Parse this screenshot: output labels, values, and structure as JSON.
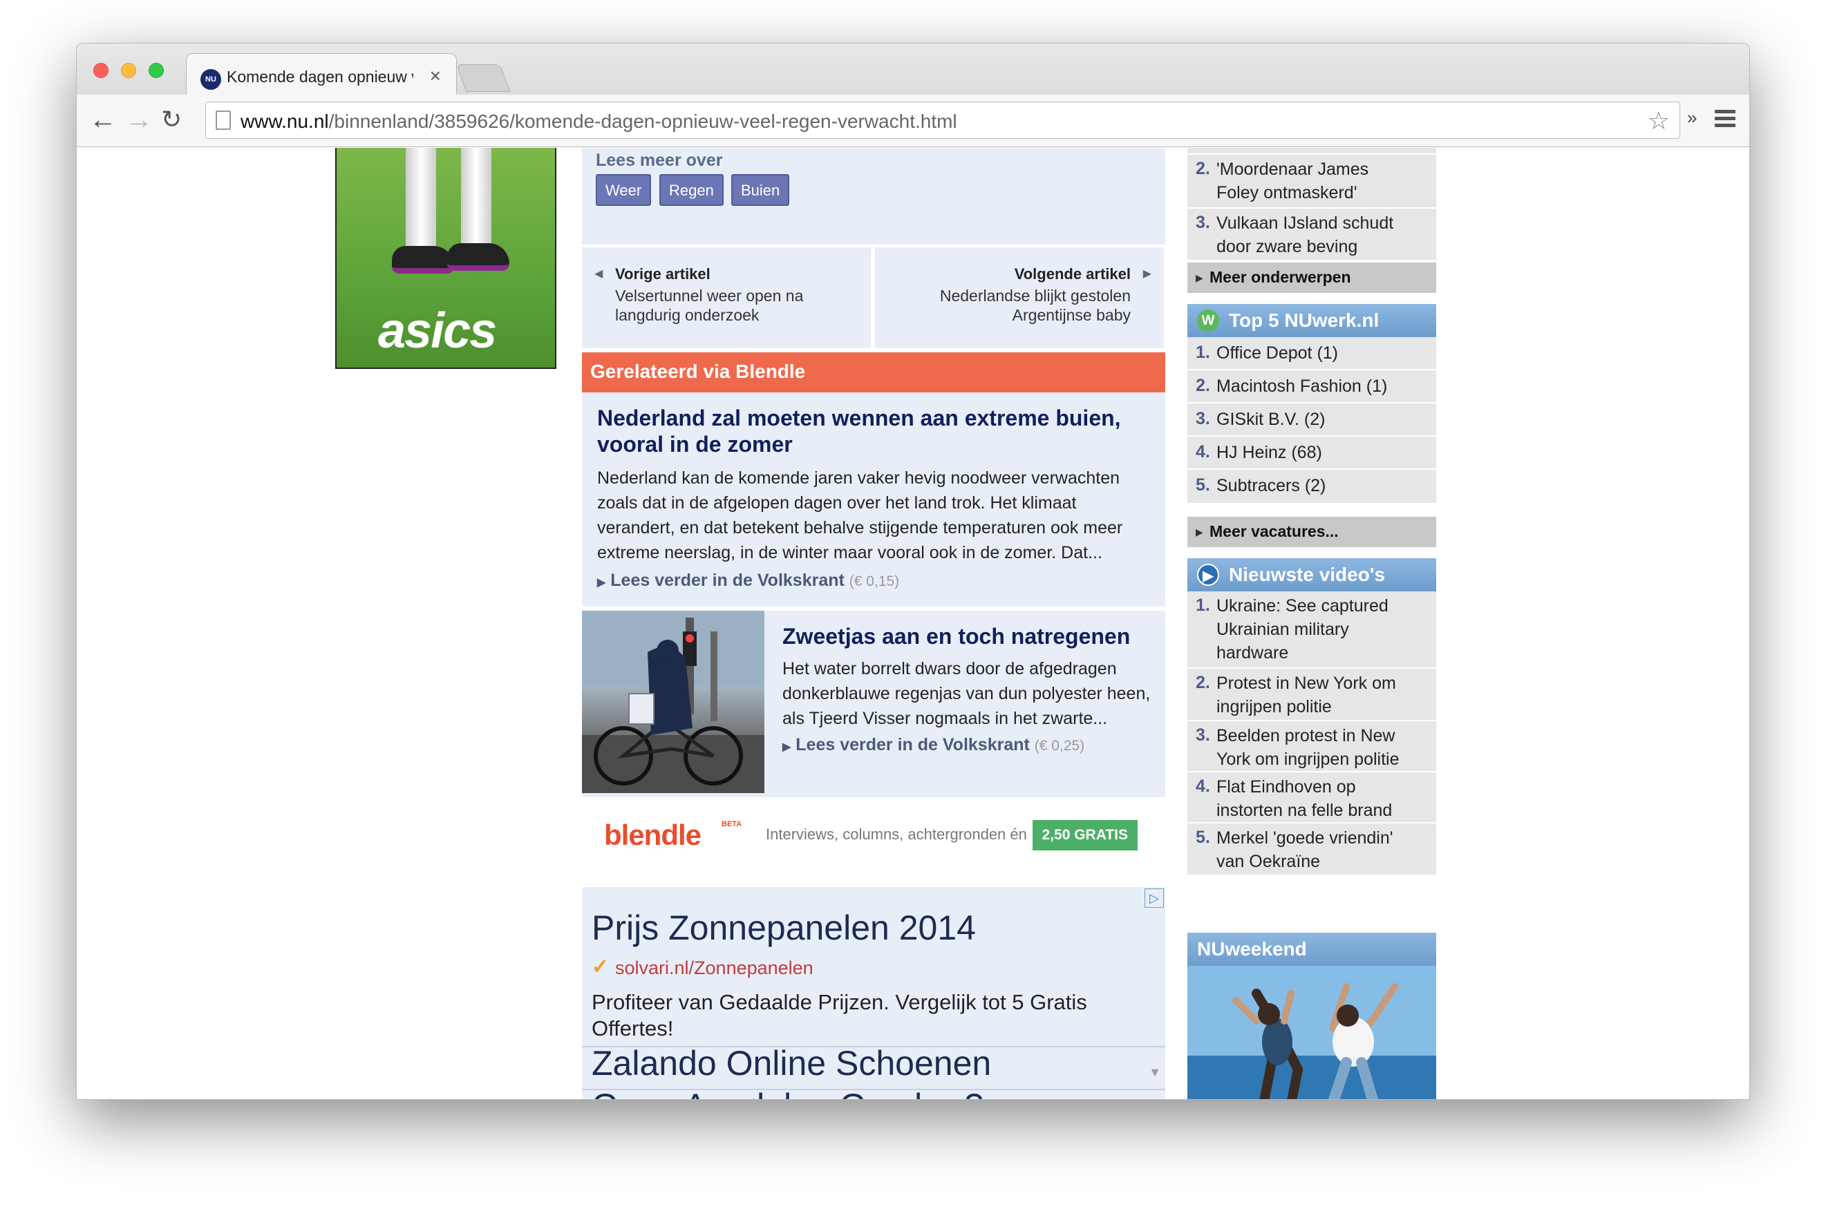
{
  "browser": {
    "tab_title": "Komende dagen opnieuw v",
    "tab_favicon": "NU",
    "url_domain": "www.nu.nl",
    "url_path": "/binnenland/3859626/komende-dagen-opnieuw-veel-regen-verwacht.html",
    "colors": {
      "close": "#fc605c",
      "minimize": "#fdbc40",
      "maximize": "#34c84a"
    }
  },
  "ad_left": {
    "brand": "asics"
  },
  "tags": {
    "title": "Lees meer over",
    "items": [
      "Weer",
      "Regen",
      "Buien"
    ]
  },
  "prev": {
    "label": "Vorige artikel",
    "line1": "Velsertunnel weer open na",
    "line2": "langdurig onderzoek"
  },
  "next": {
    "label": "Volgende artikel",
    "line1": "Nederlandse blijkt gestolen",
    "line2": "Argentijnse baby"
  },
  "blendle": {
    "header": "Gerelateerd via Blendle",
    "article1": {
      "title_line1": "Nederland zal moeten wennen aan extreme buien,",
      "title_line2": "vooral in de zomer",
      "body_lines": [
        "Nederland kan de komende jaren vaker hevig noodweer verwachten",
        "zoals dat in de afgelopen dagen over het land trok. Het klimaat",
        "verandert, en dat betekent behalve stijgende temperaturen ook meer",
        "extreme neerslag, in de winter maar vooral ook in de zomer. Dat..."
      ],
      "read_more": "Lees verder in de Volkskrant",
      "price": "(€ 0,15)"
    },
    "article2": {
      "title": "Zweetjas aan en toch natregenen",
      "body_lines": [
        "Het water borrelt dwars door de afgedragen",
        "donkerblauwe regenjas van dun polyester heen,",
        "als Tjeerd Visser nogmaals in het zwarte..."
      ],
      "read_more": "Lees verder in de Volkskrant",
      "price": "(€ 0,25)"
    },
    "logo": "blendle",
    "beta": "BETA",
    "tagline": "Interviews, columns, achtergronden én",
    "cta": "2,50 GRATIS"
  },
  "ad": {
    "title": "Prijs Zonnepanelen 2014",
    "url": "solvari.nl/Zonnepanelen",
    "desc_line1": "Profiteer van Gedaalde Prijzen. Vergelijk tot 5 Gratis",
    "desc_line2": "Offertes!",
    "title2": "Zalando Online Schoenen",
    "title3": "Geen Aandelen Gracher?"
  },
  "sidebar": {
    "top_items": [
      {
        "num": "2.",
        "line1": "'Moordenaar James",
        "line2": "Foley ontmaskerd'"
      },
      {
        "num": "3.",
        "line1": "Vulkaan IJsland schudt",
        "line2": "door zware beving"
      }
    ],
    "more_topics": "Meer onderwerpen",
    "nuwerk": {
      "title": "Top 5 NUwerk.nl",
      "icon": "W",
      "items": [
        {
          "num": "1.",
          "text": "Office Depot (1)"
        },
        {
          "num": "2.",
          "text": "Macintosh Fashion (1)"
        },
        {
          "num": "3.",
          "text": "GISkit B.V. (2)"
        },
        {
          "num": "4.",
          "text": "HJ Heinz (68)"
        },
        {
          "num": "5.",
          "text": "Subtracers (2)"
        }
      ],
      "more": "Meer vacatures..."
    },
    "videos": {
      "title": "Nieuwste video's",
      "items": [
        {
          "num": "1.",
          "lines": [
            "Ukraine: See captured",
            "Ukrainian military",
            "hardware"
          ]
        },
        {
          "num": "2.",
          "lines": [
            "Protest in New York om",
            "ingrijpen politie"
          ]
        },
        {
          "num": "3.",
          "lines": [
            "Beelden protest in New",
            "York om ingrijpen politie"
          ]
        },
        {
          "num": "4.",
          "lines": [
            "Flat Eindhoven op",
            "instorten na felle brand"
          ]
        },
        {
          "num": "5.",
          "lines": [
            "Merkel 'goede vriendin'",
            "van Oekraïne"
          ]
        }
      ]
    },
    "weekend": {
      "title": "NUweekend"
    }
  }
}
